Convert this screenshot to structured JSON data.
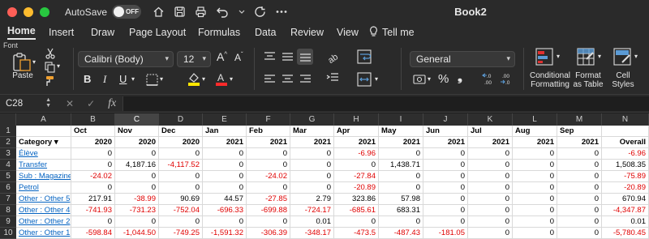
{
  "window": {
    "title": "Book2",
    "autosave_label": "AutoSave",
    "autosave_state": "OFF"
  },
  "tabs": [
    "Home",
    "Insert",
    "Draw",
    "Page Layout",
    "Formulas",
    "Data",
    "Review",
    "View"
  ],
  "tell_me": "Tell me",
  "ribbon": {
    "font_group_label": "Font",
    "paste_label": "Paste",
    "font_name": "Calibri (Body)",
    "font_size": "12",
    "number_format": "General",
    "bold": "B",
    "italic": "I",
    "underline": "U",
    "percent": "%",
    "conditional_formatting": [
      "Conditional",
      "Formatting"
    ],
    "format_as_table": [
      "Format",
      "as Table"
    ],
    "cell_styles": [
      "Cell",
      "Styles"
    ],
    "accent_fill": "#ffe600",
    "accent_font": "#ff2a2a"
  },
  "formula_bar": {
    "name_box": "C28",
    "fx_label": "fx",
    "value": ""
  },
  "grid": {
    "columns": [
      "A",
      "B",
      "C",
      "D",
      "E",
      "F",
      "G",
      "H",
      "I",
      "J",
      "K",
      "L",
      "M",
      "N"
    ],
    "selected_column": "C",
    "rows": [
      [
        "",
        "Oct",
        "Nov",
        "Dec",
        "Jan",
        "Feb",
        "Mar",
        "Apr",
        "May",
        "Jun",
        "Jul",
        "Aug",
        "Sep",
        ""
      ],
      [
        "Category ▾",
        "2020",
        "2020",
        "2020",
        "2021",
        "2021",
        "2021",
        "2021",
        "2021",
        "2021",
        "2021",
        "2021",
        "2021",
        "Overall"
      ],
      [
        "Élève",
        "0",
        "0",
        "0",
        "0",
        "0",
        "0",
        "-6.96",
        "0",
        "0",
        "0",
        "0",
        "0",
        "-6.96"
      ],
      [
        "Transfer",
        "0",
        "4,187.16",
        "-4,117.52",
        "0",
        "0",
        "0",
        "0",
        "1,438.71",
        "0",
        "0",
        "0",
        "0",
        "1,508.35"
      ],
      [
        "Sub : Magazine",
        "-24.02",
        "0",
        "0",
        "0",
        "-24.02",
        "0",
        "-27.84",
        "0",
        "0",
        "0",
        "0",
        "0",
        "-75.89"
      ],
      [
        "Petrol",
        "0",
        "0",
        "0",
        "0",
        "0",
        "0",
        "-20.89",
        "0",
        "0",
        "0",
        "0",
        "0",
        "-20.89"
      ],
      [
        "Other : Other 5",
        "217.91",
        "-38.99",
        "90.69",
        "44.57",
        "-27.85",
        "2.79",
        "323.86",
        "57.98",
        "0",
        "0",
        "0",
        "0",
        "670.94"
      ],
      [
        "Other : Other 4",
        "-741.93",
        "-731.23",
        "-752.04",
        "-696.33",
        "-699.88",
        "-724.17",
        "-685.61",
        "683.31",
        "0",
        "0",
        "0",
        "0",
        "-4,347.87"
      ],
      [
        "Other : Other 2",
        "0",
        "0",
        "0",
        "0",
        "0",
        "0.01",
        "0",
        "0",
        "0",
        "0",
        "0",
        "0",
        "0.01"
      ],
      [
        "Other : Other 1",
        "-598.84",
        "-1,044.50",
        "-749.25",
        "-1,591.32",
        "-306.39",
        "-348.17",
        "-473.5",
        "-487.43",
        "-181.05",
        "0",
        "0",
        "0",
        "-5,780.45"
      ]
    ]
  }
}
